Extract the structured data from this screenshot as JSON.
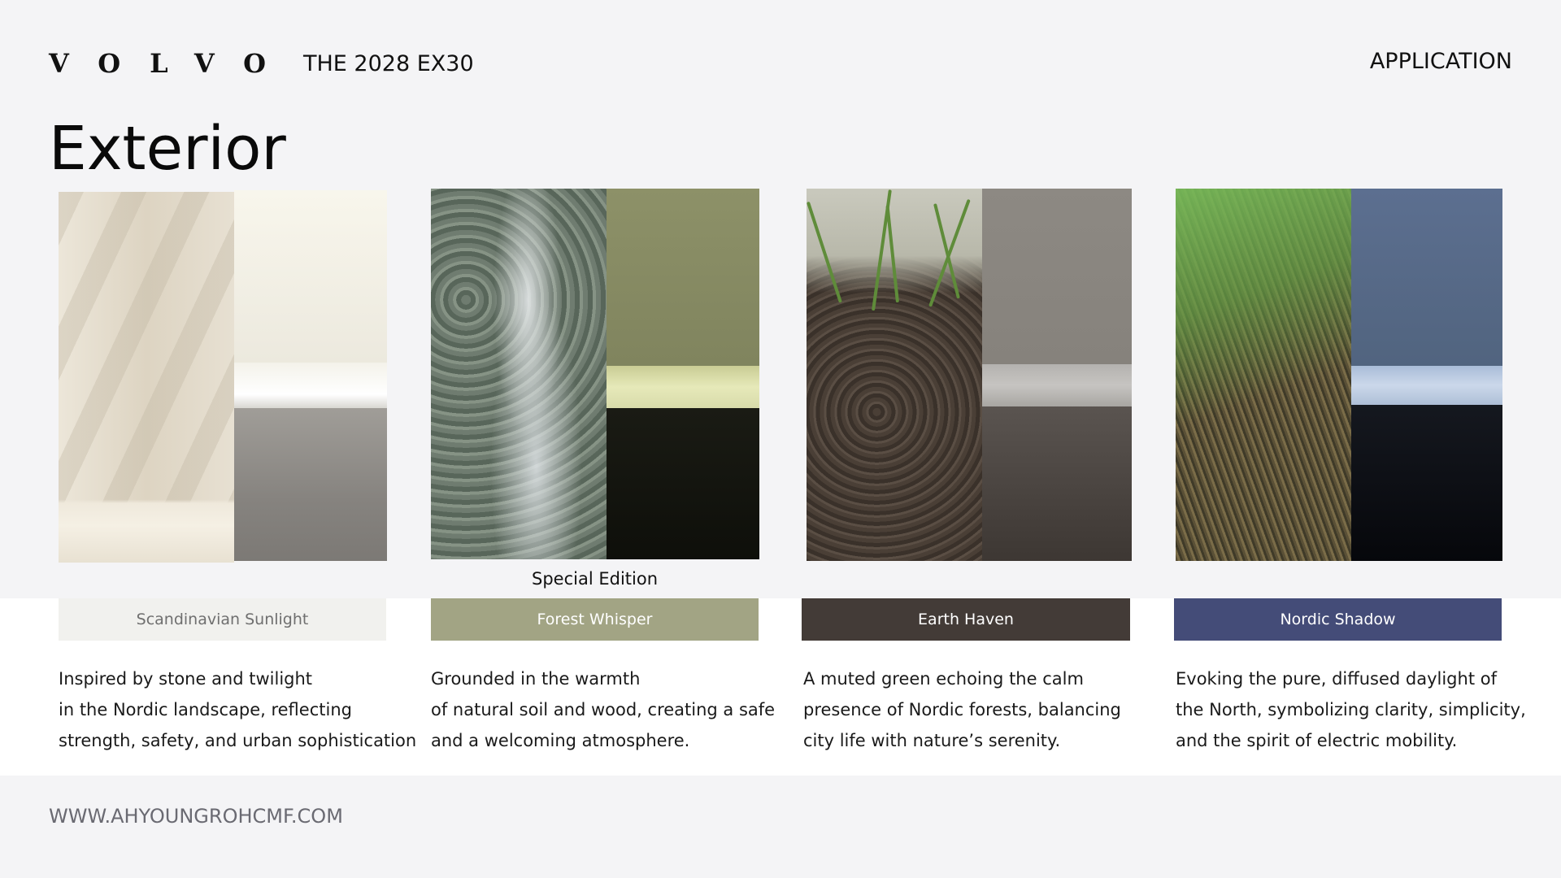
{
  "header": {
    "logo": "VOLVO",
    "model": "THE 2028 EX30",
    "section": "APPLICATION"
  },
  "page_title": "Exterior",
  "cards": [
    {
      "name": "Scandinavian Sunlight",
      "label_bg": "#f1f1ee",
      "label_color": "#6f6f6f",
      "swatch": {
        "top": "#f4f1e8",
        "mid": "#ffffff",
        "bottom": "#8a8783"
      },
      "description": [
        "Inspired by stone and twilight",
        "in the Nordic landscape, reflecting",
        "strength, safety, and urban sophistication"
      ]
    },
    {
      "name": "Forest Whisper",
      "edition": "Special Edition",
      "label_bg": "#a2a484",
      "label_color": "#ffffff",
      "swatch": {
        "top": "#8a8d66",
        "mid": "#e3e6b6",
        "bottom": "#0e0f0a"
      },
      "description": [
        "Grounded in the warmth",
        "of natural soil and wood, creating a safe",
        "and a welcoming atmosphere."
      ]
    },
    {
      "name": "Earth Haven",
      "label_bg": "#433b37",
      "label_color": "#ffffff",
      "swatch": {
        "top": "#8b8781",
        "mid": "#c2c0bd",
        "bottom": "#3d3733"
      },
      "description": [
        "A muted green echoing the calm",
        "presence of Nordic forests, balancing",
        "city life with nature’s serenity."
      ]
    },
    {
      "name": "Nordic Shadow",
      "label_bg": "#444c78",
      "label_color": "#ffffff",
      "swatch": {
        "top": "#566a8c",
        "mid": "#c6d4e8",
        "bottom": "#06070b"
      },
      "description": [
        "Evoking the pure, diffused daylight of",
        "the North, symbolizing clarity, simplicity,",
        "and the spirit of electric mobility."
      ]
    }
  ],
  "footer": "WWW.AHYOUNGROHCMF.COM"
}
